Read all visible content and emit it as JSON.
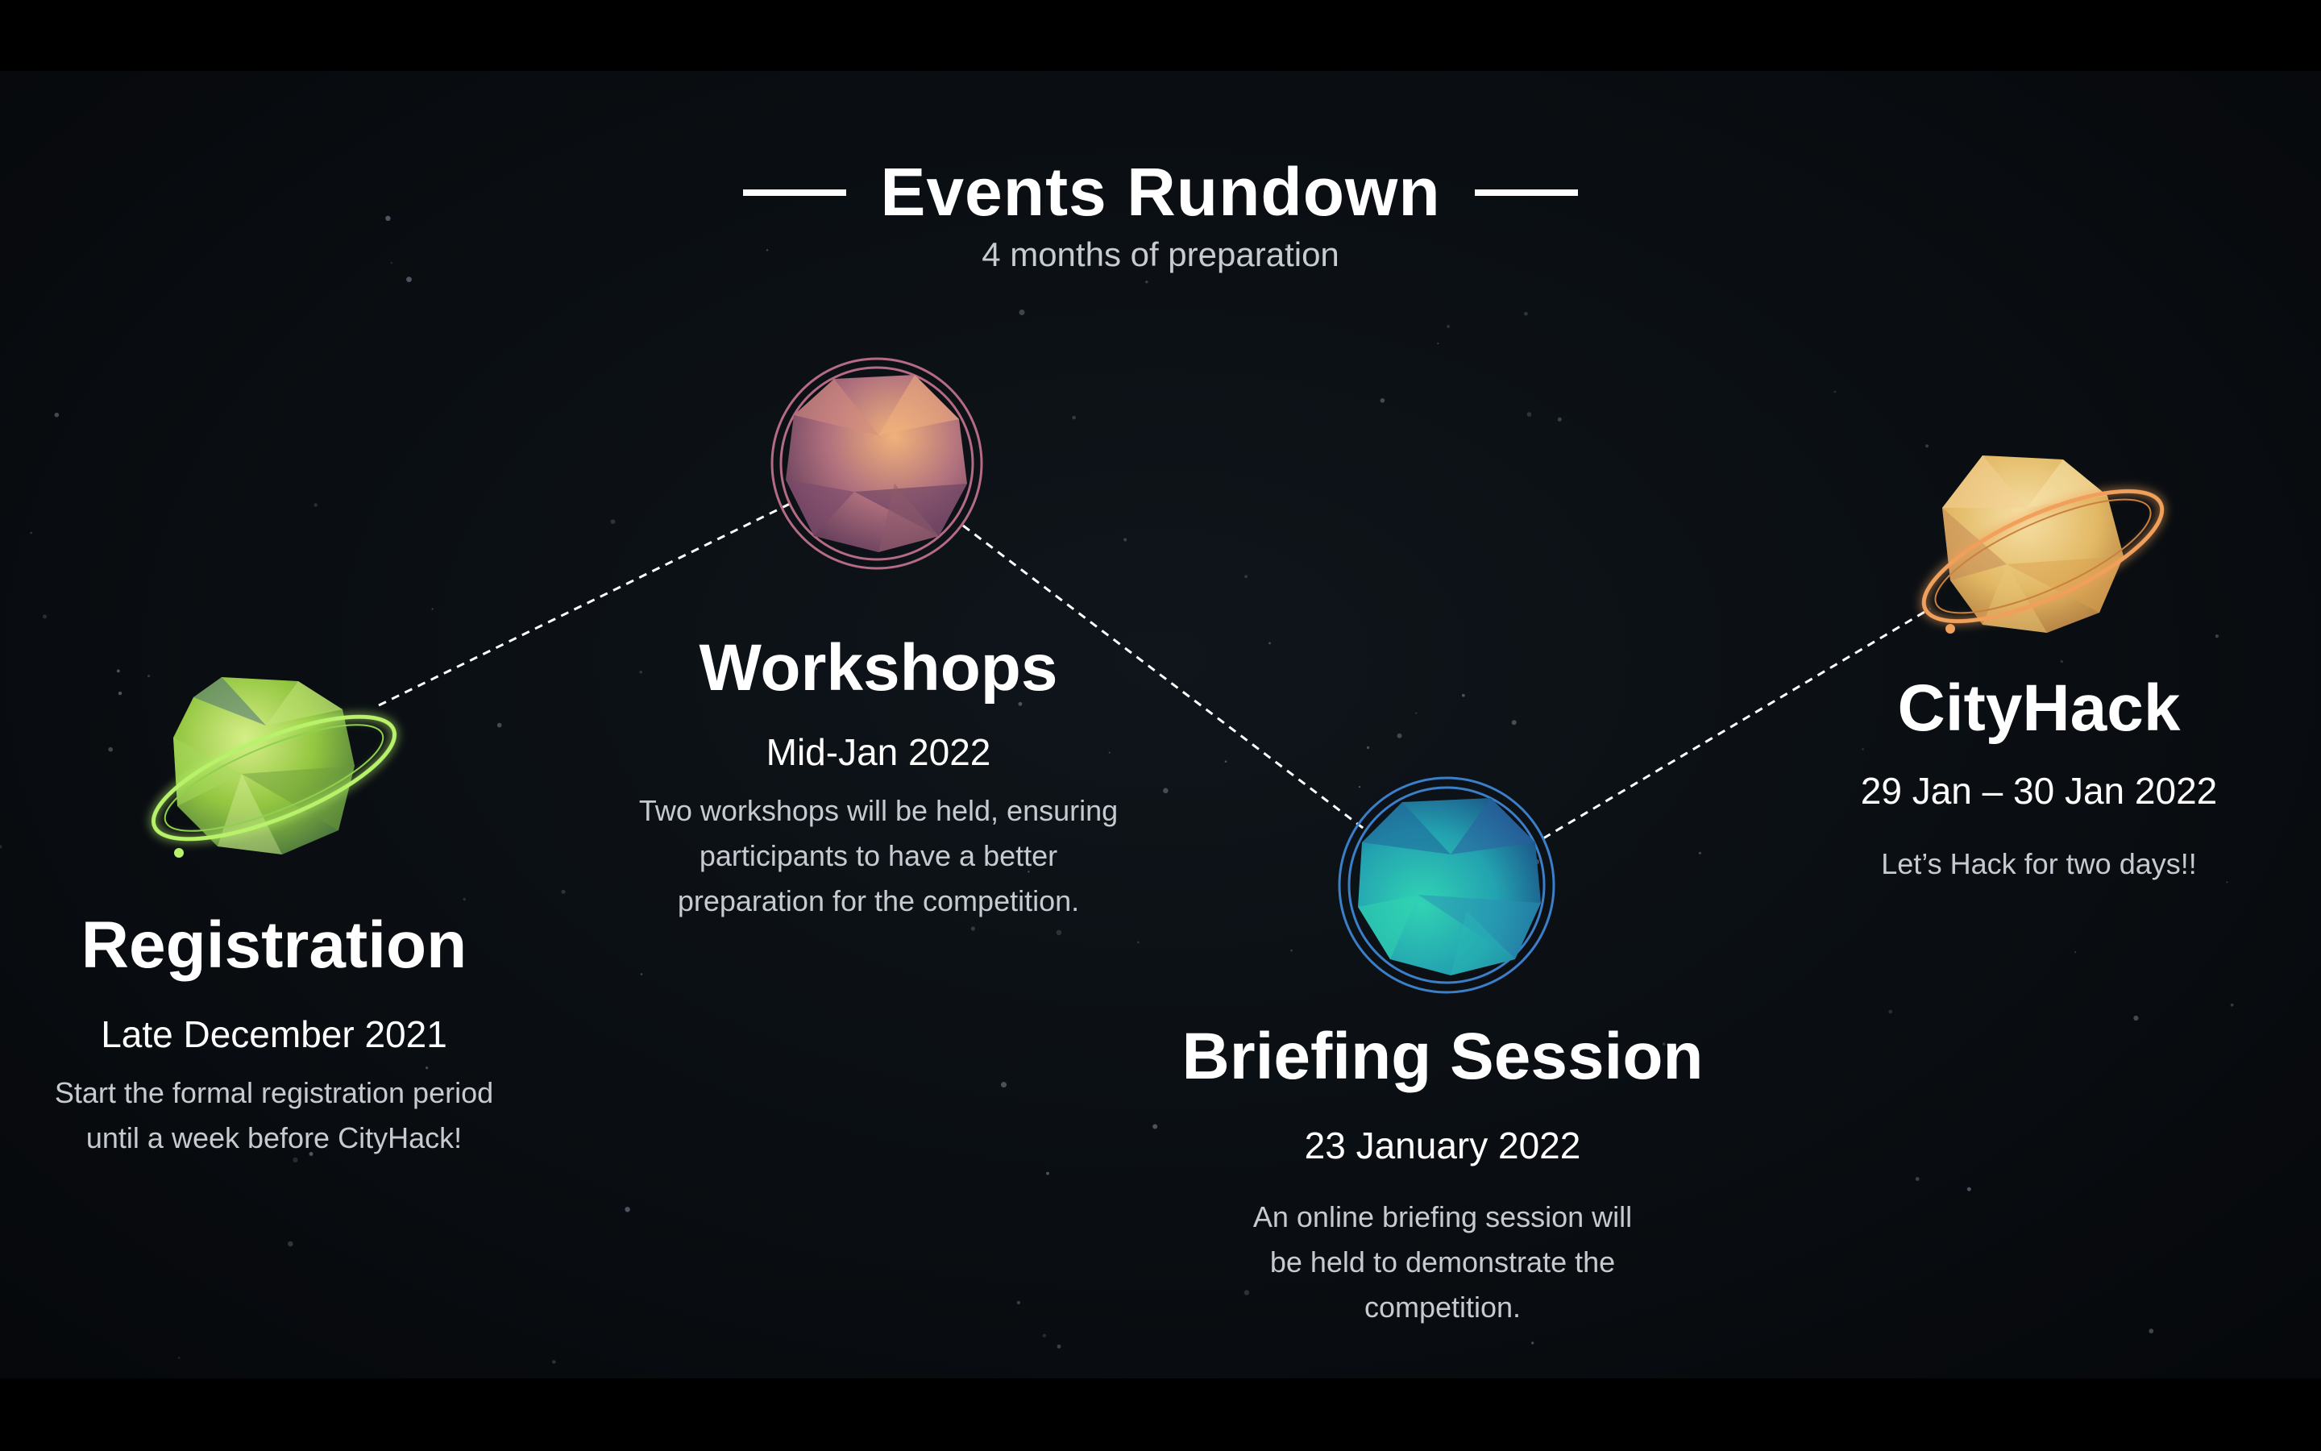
{
  "header": {
    "title": "Events Rundown",
    "subtitle": "4 months of preparation"
  },
  "events": [
    {
      "name": "Registration",
      "date": "Late December 2021",
      "description": "Start the formal registration period until a week before CityHack!",
      "planet_color": "#9ccb45",
      "planet_icon": "green-ringed-planet-icon"
    },
    {
      "name": "Workshops",
      "date": "Mid-Jan 2022",
      "description": "Two workshops will be held, ensuring participants to have a better preparation for the competition.",
      "planet_color": "#b37a86",
      "planet_icon": "pink-circled-planet-icon"
    },
    {
      "name": "Briefing Session",
      "date": "23 January 2022",
      "description": "An online briefing session will be held to demonstrate the competition.",
      "planet_color": "#2aa7b3",
      "planet_icon": "teal-circled-planet-icon"
    },
    {
      "name": "CityHack",
      "date": "29 Jan – 30 Jan 2022",
      "description": "Let’s Hack for two days!!",
      "planet_color": "#e2b86a",
      "planet_icon": "gold-ringed-planet-icon"
    }
  ],
  "colors": {
    "background": "#0a0e12",
    "text_primary": "#ffffff",
    "text_secondary": "#c7cbd1"
  }
}
